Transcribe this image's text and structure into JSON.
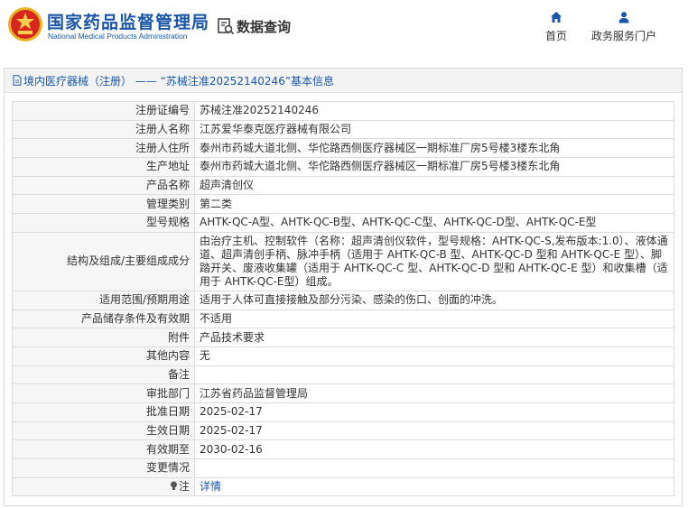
{
  "header": {
    "brand_cn": "国家药品监督管理局",
    "brand_en": "National Medical Products Administration",
    "search_label": "数据查询",
    "nav": [
      {
        "label": "首页",
        "icon": "home-icon"
      },
      {
        "label": "政务服务门户",
        "icon": "user-icon"
      }
    ]
  },
  "panel": {
    "title": "境内医疗器械（注册） —— “苏械注准20252140246”基本信息"
  },
  "rows": [
    {
      "key": "注册证编号",
      "value": "苏械注准20252140246"
    },
    {
      "key": "注册人名称",
      "value": "江苏爱华泰克医疗器械有限公司"
    },
    {
      "key": "注册人住所",
      "value": "泰州市药城大道北侧、华佗路西侧医疗器械区一期标准厂房5号楼3楼东北角"
    },
    {
      "key": "生产地址",
      "value": "泰州市药城大道北侧、华佗路西侧医疗器械区一期标准厂房5号楼3楼东北角"
    },
    {
      "key": "产品名称",
      "value": "超声清创仪"
    },
    {
      "key": "管理类别",
      "value": "第二类"
    },
    {
      "key": "型号规格",
      "value": "AHTK-QC-A型、AHTK-QC-B型、AHTK-QC-C型、AHTK-QC-D型、AHTK-QC-E型"
    },
    {
      "key": "结构及组成/主要组成成分",
      "value": "由治疗主机、控制软件（名称：超声清创仪软件，型号规格：AHTK-QC-S,发布版本:1.0）、液体通道、超声清创手柄、脉冲手柄（适用于 AHTK-QC-B 型、AHTK-QC-D 型和 AHTK-QC-E 型）、脚踏开关、废液收集罐（适用于 AHTK-QC-C 型、AHTK-QC-D 型和 AHTK-QC-E 型）和收集槽（适用于 AHTK-QC-E型）组成。"
    },
    {
      "key": "适用范围/预期用途",
      "value": "适用于人体可直接接触及部分污染、感染的伤口、创面的冲洗。"
    },
    {
      "key": "产品储存条件及有效期",
      "value": "不适用"
    },
    {
      "key": "附件",
      "value": "产品技术要求"
    },
    {
      "key": "其他内容",
      "value": "无"
    },
    {
      "key": "备注",
      "value": ""
    },
    {
      "key": "审批部门",
      "value": "江苏省药品监督管理局"
    },
    {
      "key": "批准日期",
      "value": "2025-02-17"
    },
    {
      "key": "生效日期",
      "value": "2025-02-17"
    },
    {
      "key": "有效期至",
      "value": "2030-02-16"
    },
    {
      "key": "变更情况",
      "value": ""
    }
  ],
  "note_row": {
    "key": "注",
    "link": "详情",
    "icon": "lightbulb-icon"
  },
  "colors": {
    "brand_blue": "#1a56a8",
    "logo_red": "#d8261f",
    "logo_gold": "#e6b422"
  }
}
